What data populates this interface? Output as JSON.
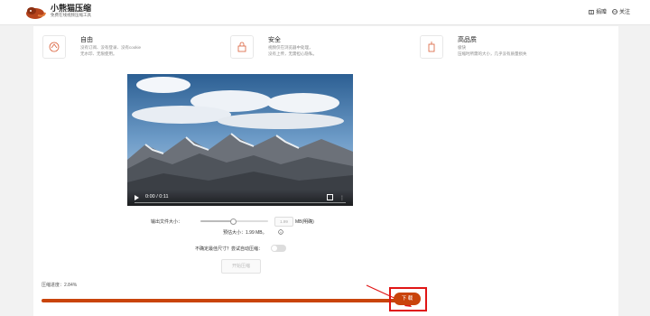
{
  "header": {
    "title": "小熊猫压缩",
    "subtitle": "免费在线视频压缩工具",
    "nav": [
      {
        "label": "捐赠",
        "icon": "gift-icon"
      },
      {
        "label": "关注",
        "icon": "globe-icon"
      }
    ]
  },
  "features": [
    {
      "title": "自由",
      "desc_line1": "没有订阅、没有登录、没有cookie",
      "desc_line2": "无水印、无限使用。",
      "icon": "freedom-icon"
    },
    {
      "title": "安全",
      "desc_line1": "视频仅在浏览器中处理，",
      "desc_line2": "没有上传，无需担心隐私。",
      "icon": "lock-icon"
    },
    {
      "title": "高品质",
      "desc_line1": "极快",
      "desc_line2": "压缩时所需的大小，几乎没有质量损失",
      "icon": "building-icon"
    }
  ],
  "video": {
    "time": "0:00 / 0:11"
  },
  "controls": {
    "output_size_label": "输出文件大小：",
    "size_input_value": "1.99",
    "unit_label": "MB(明确)",
    "estimated_label": "预估大小：1.99 MB。",
    "auto_size_label": "不确定最佳尺寸？尝试自动压缩：",
    "start_button": "开始压缩",
    "slider_fraction": 0.48
  },
  "result": {
    "ratio_text": "压缩进度：2.84%",
    "download_button": "下 载",
    "progress_fraction": 1.0
  },
  "colors": {
    "accent": "#c9440b",
    "highlight": "#e01515"
  }
}
